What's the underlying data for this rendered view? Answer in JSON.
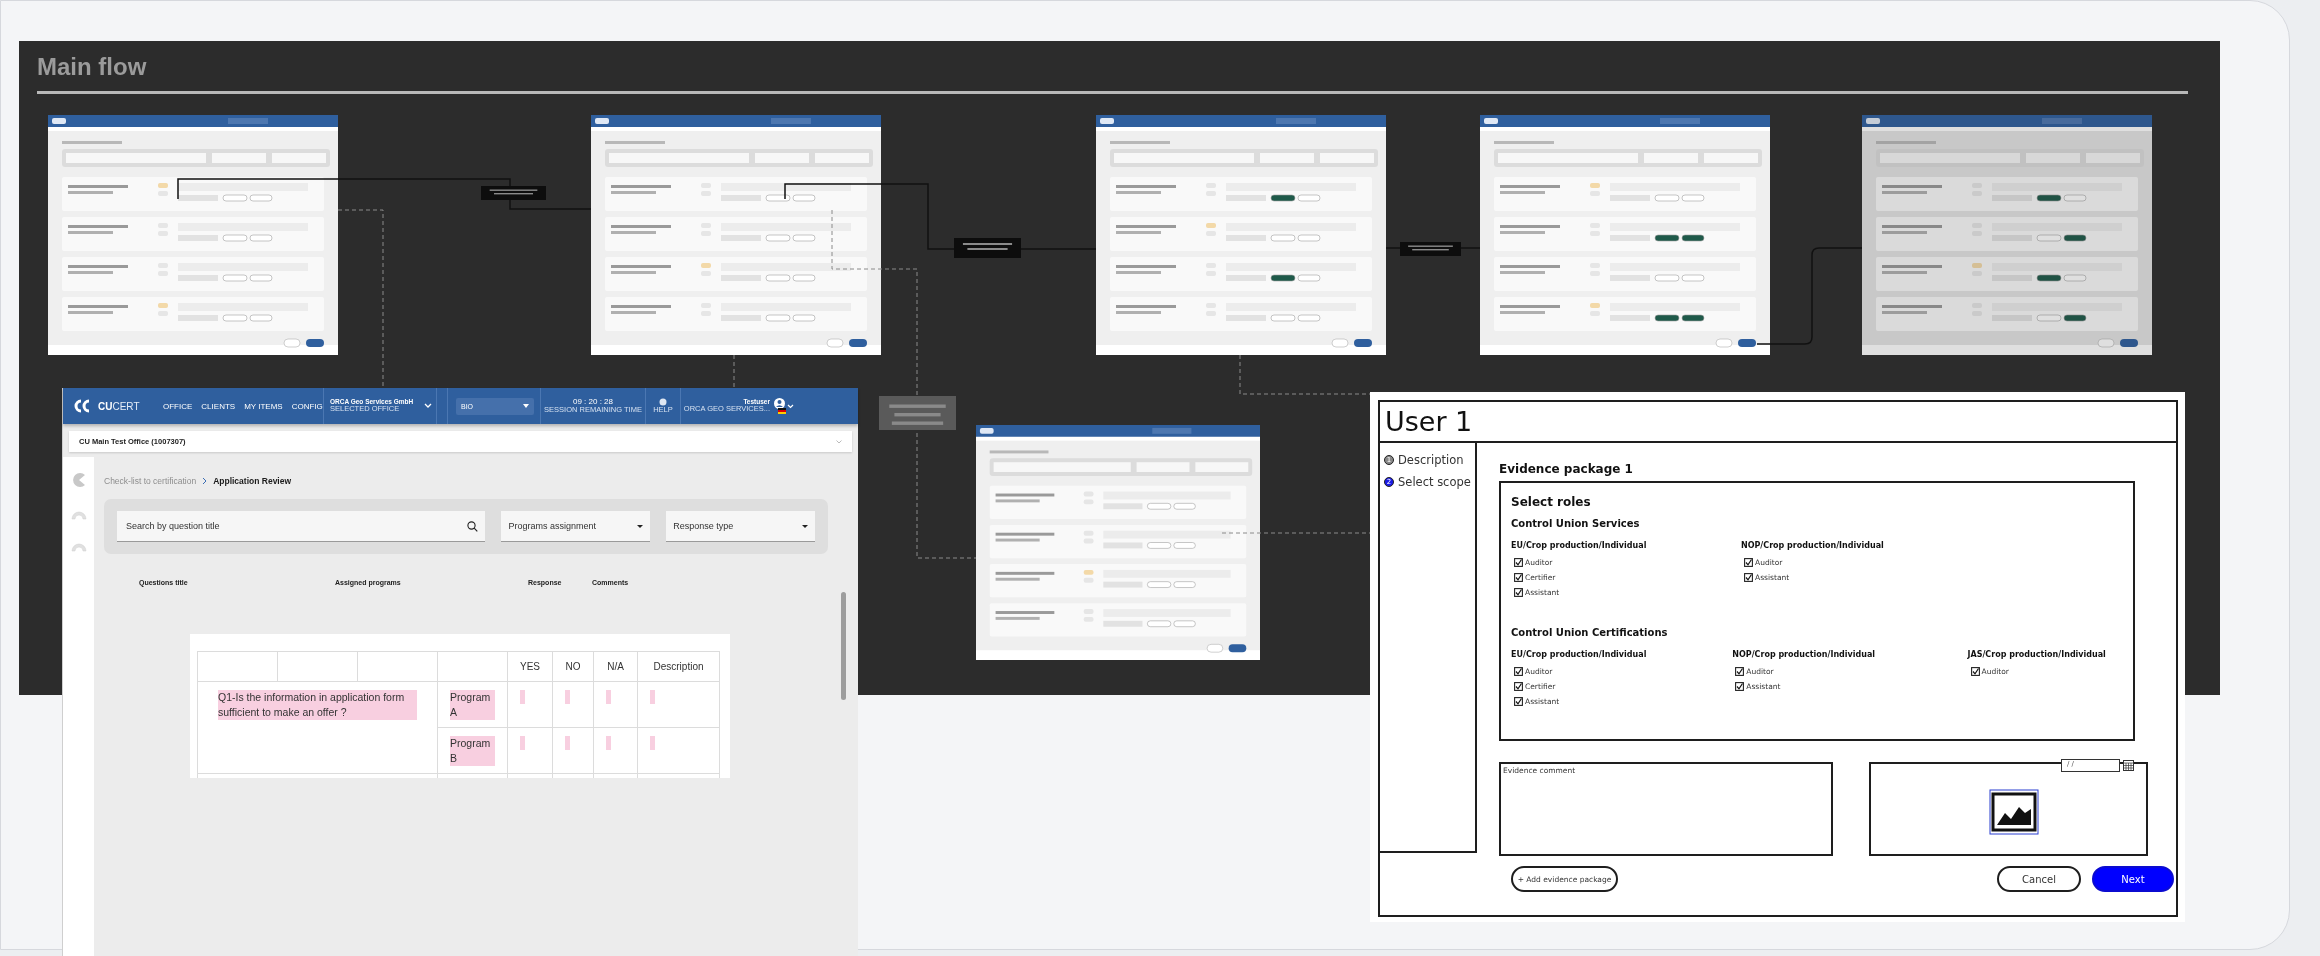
{
  "canvas": {
    "title": "Main flow"
  },
  "app_screen": {
    "header": {
      "logo_bold": "CU",
      "logo_light": "CERT",
      "nav": [
        "OFFICE",
        "CLIENTS",
        "MY ITEMS",
        "CONFIG"
      ],
      "office": {
        "name": "ORCA Geo Services GmbH",
        "caption": "SELECTED OFFICE"
      },
      "program_group": {
        "value": "BIO"
      },
      "timer": {
        "time": "09 : 20 : 28",
        "caption": "SESSION REMAINING TIME"
      },
      "help": "HELP",
      "user": {
        "name": "Testuser",
        "org": "ORCA GEO SERVICES..."
      }
    },
    "office_bar": "CU Main Test Office (1007307)",
    "breadcrumb": [
      {
        "label": "Check-list to certification",
        "selected": false
      },
      {
        "label": "Application Review",
        "selected": true
      }
    ],
    "filters": {
      "search": {
        "placeholder": "Search by question title"
      },
      "programs": "Programs assignment",
      "response": "Response type"
    },
    "columns": [
      "Questions title",
      "Assigned programs",
      "Response",
      "Comments"
    ],
    "table": {
      "header": [
        "YES",
        "NO",
        "N/A",
        "Description"
      ],
      "question": "Q1-Is the information in application form sufficient to make an offer ?",
      "programs": [
        "Program A",
        "Program B"
      ]
    }
  },
  "wireframe": {
    "title": "User 1",
    "steps": [
      {
        "number": "1",
        "label": "Description",
        "selected": false
      },
      {
        "number": "2",
        "label": "Select scope",
        "selected": true
      }
    ],
    "heading": "Evidence package 1",
    "section": "Select roles",
    "groups": [
      {
        "title": "Control Union Services",
        "scopes": [
          {
            "title": "EU/Crop production/Individual",
            "roles": [
              {
                "label": "Auditor",
                "checked": true
              },
              {
                "label": "Certifier",
                "checked": true
              },
              {
                "label": "Assistant",
                "checked": true
              }
            ]
          },
          {
            "title": "NOP/Crop production/Individual",
            "roles": [
              {
                "label": "Auditor",
                "checked": true
              },
              {
                "label": "Assistant",
                "checked": true
              }
            ]
          }
        ]
      },
      {
        "title": "Control Union Certifications",
        "scopes": [
          {
            "title": "EU/Crop production/Individual",
            "roles": [
              {
                "label": "Auditor",
                "checked": true
              },
              {
                "label": "Certifier",
                "checked": true
              },
              {
                "label": "Assistant",
                "checked": true
              }
            ]
          },
          {
            "title": "NOP/Crop production/Individual",
            "roles": [
              {
                "label": "Auditor",
                "checked": true
              },
              {
                "label": "Assistant",
                "checked": true
              }
            ]
          },
          {
            "title": "JAS/Crop production/Individual",
            "roles": [
              {
                "label": "Auditor",
                "checked": true
              }
            ]
          }
        ]
      }
    ],
    "comment": {
      "placeholder": "Evidence comment"
    },
    "date": {
      "value": "/ /"
    },
    "add_button": "+ Add evidence package",
    "buttons": [
      "Cancel",
      "Next"
    ]
  }
}
